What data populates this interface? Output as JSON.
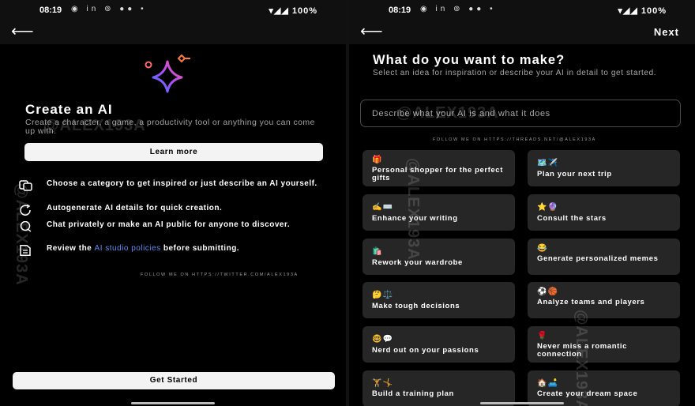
{
  "status": {
    "time": "08:19",
    "icons": "◉ in ⊚ ●● •",
    "battery": "▾◢◢ 100%"
  },
  "watermark": "@ALEX193A",
  "left": {
    "title": "Create an AI",
    "subtitle": "Create a character, a game, a productivity tool or anything you can come up with.",
    "learn_more": "Learn more",
    "features": [
      {
        "icon": "category-icon",
        "text": "Choose a category to get inspired or just describe an AI yourself."
      },
      {
        "icon": "refresh-icon",
        "text": "Autogenerate AI details for quick creation."
      },
      {
        "icon": "chat-icon",
        "text": "Chat privately or make an AI public for anyone to discover."
      }
    ],
    "review_prefix": "Review the ",
    "review_link": "AI studio policies",
    "review_suffix": " before submitting.",
    "follow": "FOLLOW ME ON HTTPS://TWITTER.COM/ALEX193A",
    "get_started": "Get Started"
  },
  "right": {
    "next": "Next",
    "title": "What do you want to make?",
    "subtitle": "Select an idea for inspiration or describe your AI in detail to get started.",
    "input_placeholder": "Describe what your AI is and what it does",
    "follow": "FOLLOW ME ON HTTPS://THREADS.NET/@ALEX193A",
    "cards": [
      {
        "emoji": "🎁",
        "label": "Personal shopper for the perfect gifts"
      },
      {
        "emoji": "🗺️✈️",
        "label": "Plan your next trip"
      },
      {
        "emoji": "✍️⌨️",
        "label": "Enhance your writing"
      },
      {
        "emoji": "⭐🔮",
        "label": "Consult the stars"
      },
      {
        "emoji": "🛍️",
        "label": "Rework your wardrobe"
      },
      {
        "emoji": "😂",
        "label": "Generate personalized memes"
      },
      {
        "emoji": "🤔⚖️",
        "label": "Make tough decisions"
      },
      {
        "emoji": "⚽🏀",
        "label": "Analyze teams and players"
      },
      {
        "emoji": "🤓💬",
        "label": "Nerd out on your passions"
      },
      {
        "emoji": "🌹",
        "label": "Never miss a romantic connection"
      },
      {
        "emoji": "🏋️🤸",
        "label": "Build a training plan"
      },
      {
        "emoji": "🏠🛋️",
        "label": "Create your dream space"
      }
    ]
  }
}
